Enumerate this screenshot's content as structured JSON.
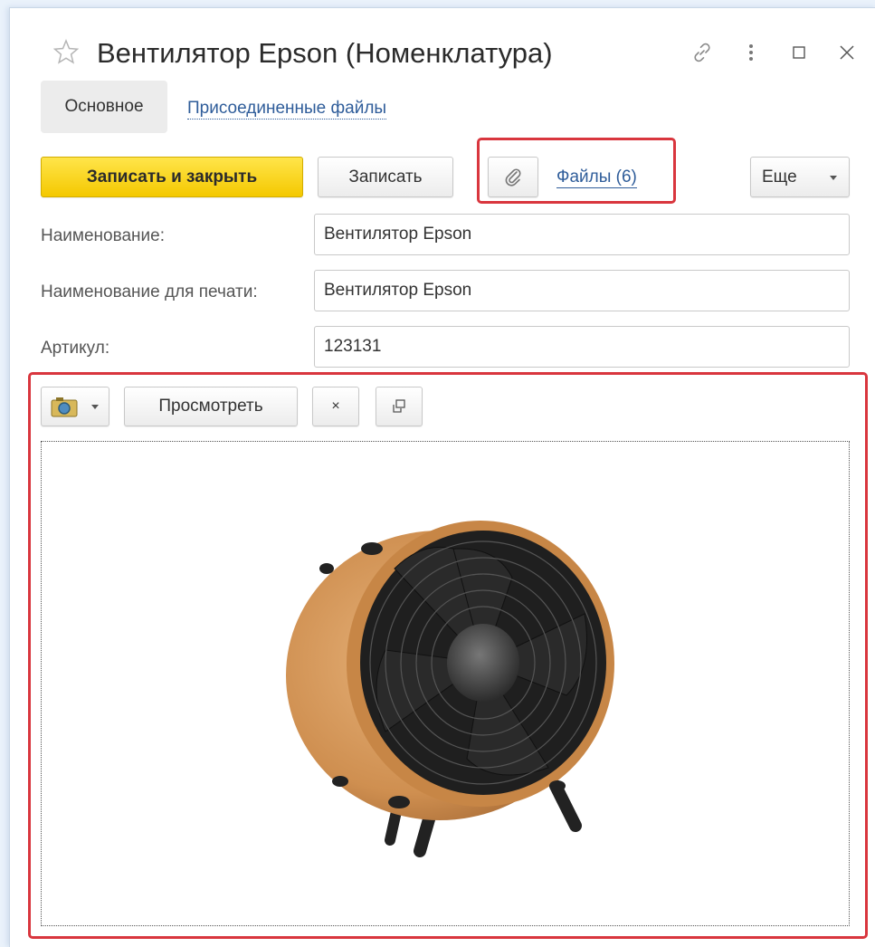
{
  "window": {
    "title": "Вентилятор Epson (Номенклатура)"
  },
  "tabs": [
    {
      "label": "Основное",
      "active": true
    },
    {
      "label": "Присоединенные файлы",
      "active": false
    }
  ],
  "toolbar": {
    "save_close_label": "Записать и закрыть",
    "save_label": "Записать",
    "files_label": "Файлы (6)",
    "more_label": "Еще"
  },
  "fields": {
    "name_label": "Наименование:",
    "name_value": "Вентилятор Epson",
    "print_name_label": "Наименование для печати:",
    "print_name_value": "Вентилятор Epson",
    "article_label": "Артикул:",
    "article_value": "123131"
  },
  "image_panel": {
    "view_label": "Просмотреть",
    "clear_label": "×",
    "image_subject": "wooden drum fan with black blades and stand legs"
  },
  "colors": {
    "accent_yellow": "#f4c800",
    "highlight_red": "#d9363e",
    "link_blue": "#2f5d9a"
  }
}
